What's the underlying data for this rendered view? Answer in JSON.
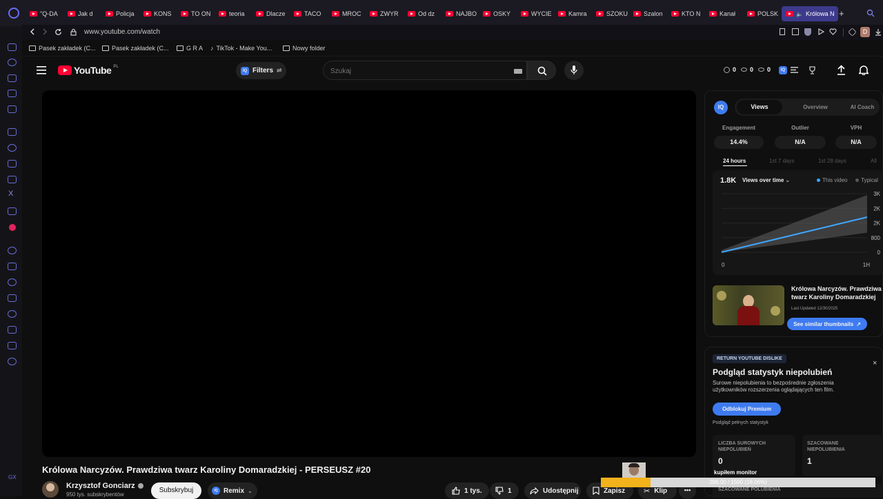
{
  "browser": {
    "tabs": [
      "\"Q-DA",
      "Jak d",
      "Policja",
      "KONS",
      "TO ON",
      "teoria",
      "Dlacze",
      "TACO",
      "MROC",
      "ZWYR",
      "Od dz",
      "NAJBO",
      "OSKY",
      "WYCIE",
      "Kamra",
      "SZOKU",
      "Szalon",
      "KTO N",
      "Kanał",
      "POLSK"
    ],
    "active_tab": "Królowa N",
    "new_tab": "+",
    "url": "www.youtube.com/watch",
    "profile_initial": "D",
    "bookmarks": [
      "Pasek zakładek (C...",
      "Pasek zakładek (C...",
      "G R A",
      "TikTok - Make You...",
      "Nowy folder"
    ]
  },
  "youtube": {
    "logo_text": "YouTube",
    "region": "PL",
    "filters_label": "Filters",
    "filters_badge": "IQ",
    "search_placeholder": "Szukaj",
    "header_stats": [
      "0",
      "0",
      "0"
    ],
    "header_iq": "IQ"
  },
  "video": {
    "title": "Królowa Narcyzów. Prawdziwa twarz Karoliny Domaradzkiej - PERSEUSZ #20",
    "channel": "Krzysztof Gonciarz",
    "subscribers": "950 tys. subskrybentów",
    "subscribe_label": "Subskrybuj",
    "remix_label": "Remix",
    "likes": "1 tys.",
    "dislikes": "1",
    "share_label": "Udostępnij",
    "save_label": "Zapisz",
    "clip_label": "Klip",
    "more_label": "•••"
  },
  "vidiq": {
    "logo": "IQ",
    "tabs": [
      "Views",
      "Overview",
      "AI Coach"
    ],
    "active_tab": "Views",
    "metrics": [
      {
        "label": "Engagement",
        "value": "14.4%"
      },
      {
        "label": "Outlier",
        "value": "N/A"
      },
      {
        "label": "VPH",
        "value": "N/A"
      }
    ],
    "ranges": [
      "24 hours",
      "1st 7 days",
      "1st 28 days",
      "All"
    ],
    "active_range": "24 hours",
    "total_views": "1.8K",
    "views_dropdown": "Views over time",
    "legend": [
      "This video",
      "Typical"
    ],
    "thumb_title": "Królowa Narcyzów. Prawdziwa twarz Karoliny Domaradzkiej",
    "thumb_updated": "Last Updated 12/30/2025",
    "similar_label": "See similar thumbnails"
  },
  "chart_data": {
    "type": "area",
    "x_ticks": [
      "0",
      "1H"
    ],
    "y_ticks": [
      "3K",
      "2K",
      "2K",
      "800",
      "0"
    ],
    "series": [
      {
        "name": "This video",
        "x": [
          0,
          1
        ],
        "values": [
          0,
          1800
        ]
      }
    ],
    "legend": [
      "This video",
      "Typical"
    ],
    "colors": {
      "this_video": "#3ea6ff",
      "typical": "#5a5a5a"
    }
  },
  "ryd": {
    "badge": "RETURN YOUTUBE DISLIKE",
    "title": "Podgląd statystyk niepolubień",
    "desc": "Surowe niepolubienia to bezpośrednie zgłoszenia użytkowników rozszerzenia oglądających ten film.",
    "unlock_label": "Odblokuj Premium",
    "preview_label": "Podgląd pełnych statystyk",
    "close": "×",
    "box1_label": "LICZBA SUROWYCH NIEPOLUBIEŃ",
    "box1_value": "0",
    "box2_label": "SZACOWANE NIEPOLUBIENIA",
    "box2_value": "1",
    "box3_label": "SZACOWANE POLUBIENIA"
  },
  "overlay": {
    "caption": "kupiłem monitor",
    "progress_text": "286.00 / 1500 (18.06%)",
    "progress": 0.1806
  },
  "colors": {
    "accent_blue": "#3e7bf0",
    "youtube_red": "#ff0033",
    "sidebar_icon": "#6b6cd8"
  }
}
